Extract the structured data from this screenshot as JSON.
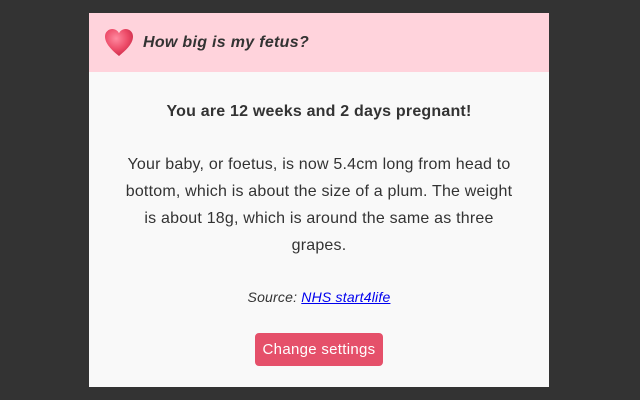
{
  "header": {
    "icon": "heart-icon",
    "title": "How big is my fetus?"
  },
  "main": {
    "headline": "You are 12 weeks and 2 days pregnant!",
    "description": "Your baby, or foetus, is now 5.4cm long from head to bottom, which is about the size of a plum. The weight is about 18g, which is around the same as three grapes.",
    "source_label": "Source:",
    "source_link": "NHS start4life",
    "button_label": "Change settings"
  },
  "colors": {
    "header_bg": "#ffd3dc",
    "accent": "#e5506a",
    "heart": "#e83f5f",
    "link": "#0000ee"
  }
}
